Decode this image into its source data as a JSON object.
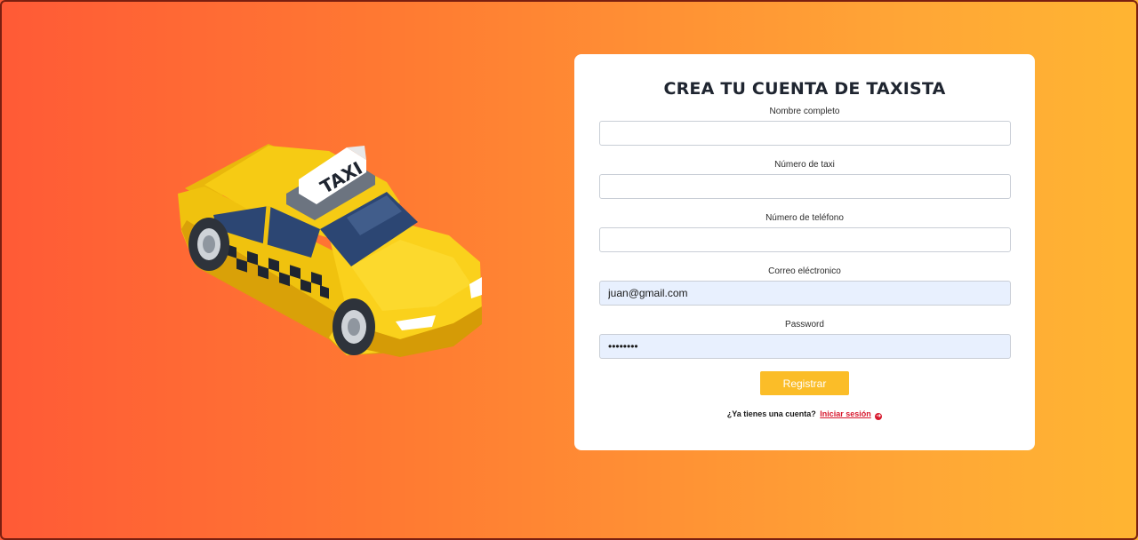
{
  "colors": {
    "gradient_start": "#ff5a36",
    "gradient_end": "#ffb532",
    "accent_button": "#fbbd28",
    "link": "#d7192e",
    "autofill_bg": "#e8f0fe"
  },
  "illustration": {
    "icon": "taxi-car-icon",
    "sign_text": "TAXI"
  },
  "form": {
    "title": "CREA TU CUENTA DE TAXISTA",
    "fields": [
      {
        "label": "Nombre completo",
        "value": "",
        "type": "text"
      },
      {
        "label": "Número de taxi",
        "value": "",
        "type": "text"
      },
      {
        "label": "Número de teléfono",
        "value": "",
        "type": "text"
      },
      {
        "label": "Correo eléctronico",
        "value": "juan@gmail.com",
        "type": "email"
      },
      {
        "label": "Password",
        "value": "••••••••",
        "type": "password"
      }
    ],
    "submit_label": "Registrar",
    "login_prompt": "¿Ya tienes una cuenta?",
    "login_link": "Iniciar sesión",
    "login_icon": "arrow-right-circle-icon"
  }
}
